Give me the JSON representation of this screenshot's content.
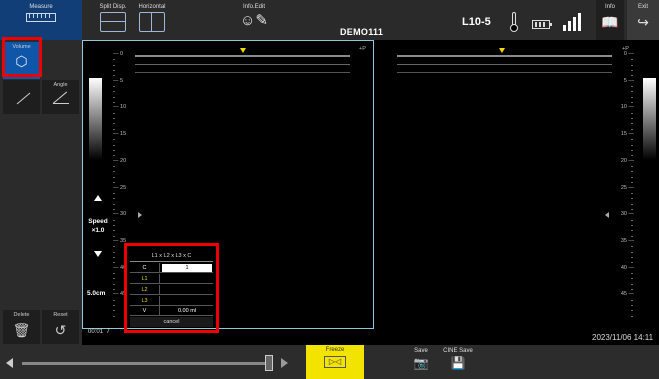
{
  "toolbar": {
    "measure_label": "Measure",
    "split_disp_label": "Split Disp.",
    "horizontal_label": "Horizontal",
    "info_edit_label": "Info.Edit",
    "patient_id": "DEMO111",
    "probe": "L10-5",
    "info_label": "Info",
    "exit_label": "Exit"
  },
  "left_panel": {
    "volume_label": "Volume",
    "angle_label": "Angle",
    "delete_label": "Delete",
    "reset_label": "Reset"
  },
  "image": {
    "left_depth_ticks": [
      "0",
      "5",
      "10",
      "15",
      "20",
      "25",
      "30",
      "35",
      "40",
      "45"
    ],
    "right_depth_ticks": [
      "0",
      "5",
      "10",
      "15",
      "20",
      "25",
      "30",
      "35",
      "40",
      "45"
    ],
    "speed_label": "Speed",
    "speed_value": "×1.0",
    "depth": "5.0cm",
    "cine_time": "00:01",
    "cine_frame": "7",
    "datetime": "2023/11/06 14:11",
    "corner_mark": "+P"
  },
  "volume_table": {
    "title": "L1 x L2 x L3 x C",
    "rows": [
      {
        "key": "C",
        "value": "1",
        "key_color": "#ffffff"
      },
      {
        "key": "L1",
        "value": "",
        "key_color": "#f2d900"
      },
      {
        "key": "L2",
        "value": "",
        "key_color": "#f2d900"
      },
      {
        "key": "L3",
        "value": "",
        "key_color": "#f2d900"
      },
      {
        "key": "V",
        "value": "0.00 ml",
        "key_color": "#ffffff"
      }
    ],
    "cancel_label": "cancel"
  },
  "bottom_bar": {
    "freeze_label": "Freeze",
    "save_label": "Save",
    "cine_save_label": "CINE Save"
  },
  "colors": {
    "highlight": "#ee0000",
    "freeze": "#f2e300",
    "measure_bg": "#123e78",
    "volume_bg": "#0f55a8",
    "screen_border": "#8fc8dc",
    "marker": "#f2d900"
  },
  "icons": {
    "measure": "ruler-icon",
    "split": "split-vertical-icon",
    "horizontal": "split-horizontal-icon",
    "info_edit": "edit-person-icon",
    "thermo": "thermometer-icon",
    "battery": "battery-icon",
    "signal": "signal-icon",
    "info": "book-icon",
    "exit": "exit-icon",
    "volume": "cube-icon",
    "distance": "line-measure-icon",
    "angle": "angle-icon",
    "delete": "trash-icon",
    "reset": "reset-icon",
    "freeze": "freeze-icon",
    "save": "camera-icon",
    "cine_save": "cine-save-icon"
  }
}
